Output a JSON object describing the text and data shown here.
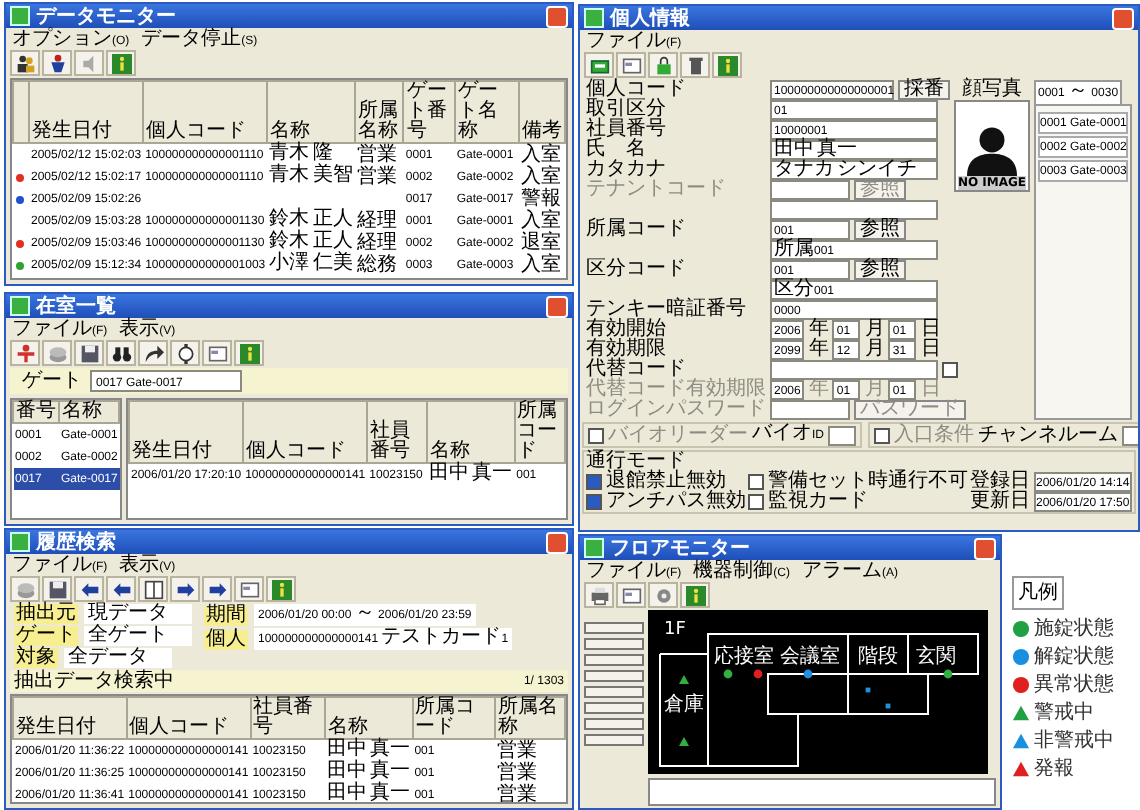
{
  "data_monitor": {
    "title": "データモニター",
    "menu": [
      "オプション(O)",
      "データ停止(S)"
    ],
    "columns": [
      "発生日付",
      "個人コード",
      "名称",
      "所属名称",
      "ゲート番号",
      "ゲート名称",
      "備考"
    ],
    "rows": [
      {
        "cells": [
          "2005/02/12 15:02:03",
          "100000000000001110",
          "青木 隆",
          "営業",
          "0001",
          "Gate-0001",
          "入室"
        ]
      },
      {
        "color": "#e03020",
        "cells": [
          "2005/02/12 15:02:17",
          "100000000000001110",
          "青木 美智",
          "営業",
          "0002",
          "Gate-0002",
          "入室"
        ]
      },
      {
        "color": "#2050d0",
        "cells": [
          "2005/02/09 15:02:26",
          "",
          "",
          "",
          "0017",
          "Gate-0017",
          "警報"
        ]
      },
      {
        "cells": [
          "2005/02/09 15:03:28",
          "100000000000001130",
          "鈴木 正人",
          "経理",
          "0001",
          "Gate-0001",
          "入室"
        ]
      },
      {
        "color": "#e03020",
        "cells": [
          "2005/02/09 15:03:46",
          "100000000000001130",
          "鈴木 正人",
          "経理",
          "0002",
          "Gate-0002",
          "退室"
        ]
      },
      {
        "color": "#30a030",
        "cells": [
          "2005/02/09 15:12:34",
          "100000000000001003",
          "小澤 仁美",
          "総務",
          "0003",
          "Gate-0003",
          "入室"
        ]
      }
    ]
  },
  "occupancy": {
    "title": "在室一覧",
    "menu": [
      "ファイル(F)",
      "表示(V)"
    ],
    "gate_label": "ゲート",
    "gate_value": "0017 Gate-0017",
    "gate_columns": [
      "番号",
      "名称"
    ],
    "gates": [
      {
        "cells": [
          "0001",
          "Gate-0001"
        ],
        "selected": false
      },
      {
        "cells": [
          "0002",
          "Gate-0002"
        ],
        "selected": false
      },
      {
        "cells": [
          "0017",
          "Gate-0017"
        ],
        "selected": true
      }
    ],
    "columns": [
      "発生日付",
      "個人コード",
      "社員番号",
      "名称",
      "所属コード"
    ],
    "rows": [
      {
        "cells": [
          "2006/01/20 17:20:10",
          "100000000000000141",
          "10023150",
          "田中 真一",
          "001"
        ]
      }
    ]
  },
  "history": {
    "title": "履歴検索",
    "menu": [
      "ファイル(F)",
      "表示(V)"
    ],
    "filters_left": [
      {
        "label": "抽出元",
        "value": "現データ"
      },
      {
        "label": "ゲート",
        "value": "全ゲート"
      },
      {
        "label": "対象",
        "value": "全データ"
      }
    ],
    "filters_right": [
      {
        "label": "期間",
        "value": "2006/01/20 00:00 ～ 2006/01/20 23:59"
      },
      {
        "label": "個人",
        "value": "100000000000000141 テストカード1"
      }
    ],
    "status": "抽出データ検索中",
    "count": "1/ 1303",
    "columns": [
      "発生日付",
      "個人コード",
      "社員番号",
      "名称",
      "所属コード",
      "所属名称"
    ],
    "rows": [
      {
        "cells": [
          "2006/01/20 11:36:22",
          "100000000000000141",
          "10023150",
          "田中 真一",
          "001",
          "営業"
        ]
      },
      {
        "cells": [
          "2006/01/20 11:36:25",
          "100000000000000141",
          "10023150",
          "田中 真一",
          "001",
          "営業"
        ]
      },
      {
        "cells": [
          "2006/01/20 11:36:41",
          "100000000000000141",
          "10023150",
          "田中 真一",
          "001",
          "営業"
        ]
      }
    ]
  },
  "person": {
    "title": "個人情報",
    "menu": [
      "ファイル(F)"
    ],
    "fields": [
      {
        "kind": "text",
        "label": "個人コード",
        "value": "100000000000000001",
        "button": "採番"
      },
      {
        "kind": "text",
        "label": "取引区分",
        "value": "01"
      },
      {
        "kind": "text",
        "label": "社員番号",
        "value": "10000001"
      },
      {
        "kind": "text",
        "label": "氏　名",
        "value": "田中 真一"
      },
      {
        "kind": "text",
        "label": "カタカナ",
        "value": "タナカ シンイチ"
      },
      {
        "kind": "text",
        "label": "テナントコード",
        "button": "参照",
        "disabled": true
      },
      {
        "kind": "line"
      },
      {
        "kind": "text",
        "label": "所属コード",
        "value": "001",
        "button": "参照"
      },
      {
        "kind": "line",
        "value": "所属001"
      },
      {
        "kind": "text",
        "label": "区分コード",
        "value": "001",
        "button": "参照"
      },
      {
        "kind": "line",
        "value": "区分001"
      },
      {
        "kind": "text",
        "label": "テンキー暗証番号",
        "value": "0000"
      },
      {
        "kind": "date",
        "label": "有効開始",
        "parts": [
          {
            "value": "2006",
            "unit": "年"
          },
          {
            "value": "01",
            "unit": "月"
          },
          {
            "value": "01",
            "unit": "日"
          }
        ]
      },
      {
        "kind": "date",
        "label": "有効期限",
        "parts": [
          {
            "value": "2099",
            "unit": "年"
          },
          {
            "value": "12",
            "unit": "月"
          },
          {
            "value": "31",
            "unit": "日"
          }
        ]
      },
      {
        "kind": "check",
        "label": "代替コード",
        "checked": false
      },
      {
        "kind": "date",
        "label": "代替コード有効期限",
        "disabled": true,
        "parts": [
          {
            "value": "2006",
            "unit": "年"
          },
          {
            "value": "01",
            "unit": "月"
          },
          {
            "value": "01",
            "unit": "日"
          }
        ]
      },
      {
        "kind": "text",
        "label": "ログインパスワード",
        "button": "パスワード",
        "disabled": true
      }
    ],
    "photo_label": "顔写真",
    "photo_text": "NO IMAGE",
    "gate_tab": "0001 ～ 0030",
    "gates": [
      "0001 Gate-0001",
      "0002 Gate-0002",
      "0003 Gate-0003"
    ],
    "options": [
      {
        "title": "バイオリーダー",
        "checked": false,
        "field_label": "バイオID"
      },
      {
        "title": "入口条件",
        "checked": false,
        "field_label": "チャンネルーム"
      }
    ],
    "mode_title": "通行モード",
    "modes": [
      {
        "label": "退館禁止無効",
        "checked": true
      },
      {
        "label": "警備セット時通行不可",
        "checked": false
      },
      {
        "label": "アンチパス無効",
        "checked": true
      },
      {
        "label": "監視カード",
        "checked": false
      }
    ],
    "dates": [
      {
        "label": "登録日",
        "value": "2006/01/20 14:14"
      },
      {
        "label": "更新日",
        "value": "2006/01/20 17:50"
      }
    ]
  },
  "floor_monitor": {
    "title": "フロアモニター",
    "menu": [
      "ファイル(F)",
      "機器制御(C)",
      "アラーム(A)"
    ],
    "floor": "1F",
    "rooms": [
      "応接室",
      "会議室",
      "階段",
      "玄関",
      "倉庫"
    ],
    "markers": [
      {
        "kind": "dot",
        "color": "#30b040"
      },
      {
        "kind": "dot",
        "color": "#e02020"
      },
      {
        "kind": "dot",
        "color": "#2090e0"
      },
      {
        "kind": "dot",
        "color": "#30b040"
      },
      {
        "kind": "triangle",
        "color": "#30b040"
      },
      {
        "kind": "triangle",
        "color": "#30b040"
      },
      {
        "kind": "square",
        "color": "#2090e0"
      },
      {
        "kind": "square",
        "color": "#2090e0"
      }
    ]
  },
  "legend": {
    "title": "凡例",
    "items": [
      {
        "kind": "dot",
        "color": "#20a040",
        "label": "施錠状態"
      },
      {
        "kind": "dot",
        "color": "#1890e0",
        "label": "解錠状態"
      },
      {
        "kind": "dot",
        "color": "#e02020",
        "label": "異常状態"
      },
      {
        "kind": "triangle",
        "color": "#20a040",
        "label": "警戒中"
      },
      {
        "kind": "triangle",
        "color": "#1890e0",
        "label": "非警戒中"
      },
      {
        "kind": "triangle",
        "color": "#e02020",
        "label": "発報"
      }
    ]
  }
}
